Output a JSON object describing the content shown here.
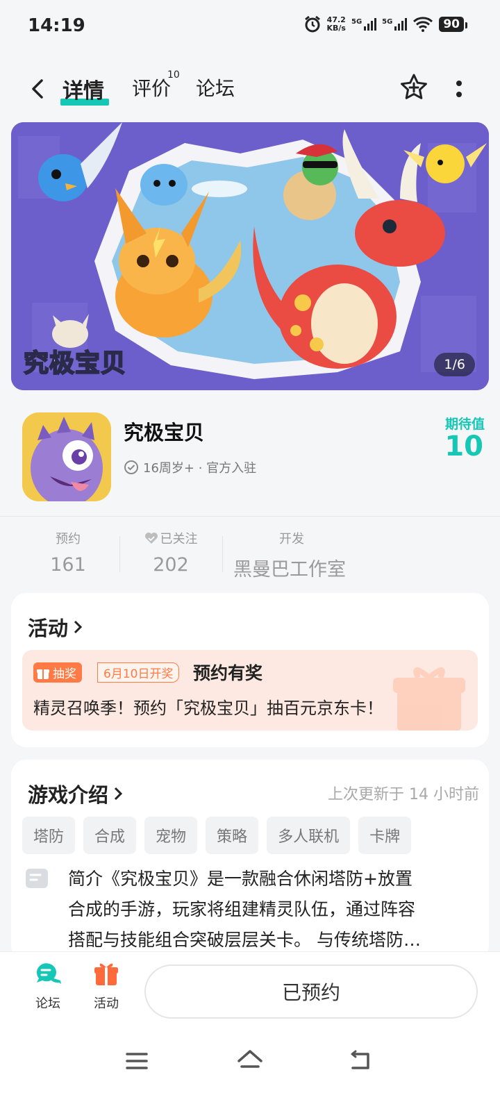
{
  "status_bar": {
    "time": "14:19",
    "net_speed": "47.2",
    "net_unit": "KB/s",
    "sim1": "5G",
    "sim2": "5G",
    "battery": "90"
  },
  "nav": {
    "tabs": [
      {
        "label": "详情"
      },
      {
        "label": "评价",
        "count": "10"
      },
      {
        "label": "论坛"
      }
    ]
  },
  "banner": {
    "logo_text": "究极宝贝",
    "pager": "1/6"
  },
  "app": {
    "name": "究极宝贝",
    "meta": "16周岁+ · 官方入驻",
    "expect_label": "期待值",
    "expect_value": "10"
  },
  "stats": {
    "reserve_label": "预约",
    "reserve_value": "161",
    "follow_label": "已关注",
    "follow_value": "202",
    "dev_label": "开发",
    "dev_value": "黑曼巴工作室"
  },
  "activity": {
    "title": "活动",
    "badge": "抽奖",
    "date_badge": "6月10日开奖",
    "promo_title": "预约有奖",
    "promo_desc": "精灵召唤季！预约「究极宝贝」抽百元京东卡！"
  },
  "intro": {
    "title": "游戏介绍",
    "updated": "上次更新于 14 小时前",
    "tags": [
      "塔防",
      "合成",
      "宠物",
      "策略",
      "多人联机",
      "卡牌"
    ],
    "lines": [
      "简介《究极宝贝》是一款融合休闲塔防+放置",
      "合成的手游，玩家将组建精灵队伍，通过阵容",
      "搭配与技能组合突破层层关卡。 与传统塔防…"
    ]
  },
  "bottom": {
    "forum_label": "论坛",
    "activity_label": "活动",
    "button_label": "已预约"
  },
  "colors": {
    "accent": "#17c7b6",
    "orange": "#ff7a45"
  }
}
